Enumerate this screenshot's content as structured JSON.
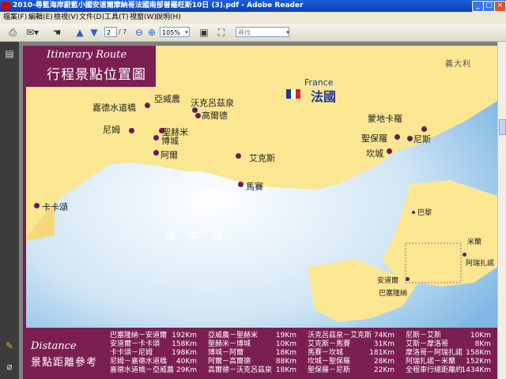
{
  "window": {
    "title": "2010-尋藍海岸蔚藍小國安道爾摩納哥法國南部普羅旺斯10日 (3).pdf - Adobe Reader",
    "minimize": "_",
    "maximize": "□",
    "close": "×"
  },
  "menu": [
    "檔案(F)",
    "編輯(E)",
    "檢視(V)",
    "文件(D)",
    "工具(T)",
    "視窗(W)",
    "說明(H)"
  ],
  "toolbar": {
    "page_current": "2",
    "page_total": "/ 7",
    "zoom": "105%",
    "search_placeholder": "尋找",
    "icons": [
      "print-icon",
      "email-icon",
      "hand-icon",
      "prev-page-icon",
      "next-page-icon",
      "zoom-out-icon",
      "zoom-in-icon",
      "fit-page-icon",
      "full-screen-icon"
    ]
  },
  "sidebar": {
    "icons": [
      "pages-icon",
      "comments-icon",
      "attachments-icon"
    ]
  },
  "page": {
    "itinerary": {
      "en": "Itinerary Route",
      "zh": "行程景點位置圖"
    },
    "country_en": "France",
    "country_zh": "法國",
    "neighbor": "義大利",
    "sea": "地 中 海",
    "flag_colors": [
      "#1e3a96",
      "#ffffff",
      "#d0262e"
    ],
    "places": [
      "嘉德水道橋",
      "亞威農",
      "沃克呂茲泉",
      "高爾德",
      "尼姆",
      "聖赫米",
      "博城",
      "阿爾",
      "艾克斯",
      "馬賽",
      "卡卡頌",
      "蒙地卡羅",
      "聖保羅",
      "尼斯",
      "坎城",
      "巴黎",
      "米蘭",
      "阿瑞扎諾",
      "安道爾",
      "巴塞隆納"
    ],
    "distance": {
      "en": "Distance",
      "zh": "景點距離參考",
      "columns": [
        [
          {
            "route": "巴塞隆納－安道爾",
            "km": "192Km"
          },
          {
            "route": "安道爾－卡卡頌",
            "km": "158Km"
          },
          {
            "route": "卡卡頌－尼姆",
            "km": "198Km"
          },
          {
            "route": "尼姆－嘉德水道橋",
            "km": "40Km"
          },
          {
            "route": "嘉德水道橋－亞威農",
            "km": "29Km"
          }
        ],
        [
          {
            "route": "亞威農－聖赫米",
            "km": "19Km"
          },
          {
            "route": "聖赫米－博城",
            "km": "10Km"
          },
          {
            "route": "博城－阿爾",
            "km": "18Km"
          },
          {
            "route": "阿爾－高爾德",
            "km": "88Km"
          },
          {
            "route": "高爾德－沃克呂茲泉",
            "km": "18Km"
          }
        ],
        [
          {
            "route": "沃克呂茲泉－艾克斯",
            "km": "74Km"
          },
          {
            "route": "艾克斯－馬賽",
            "km": "31Km"
          },
          {
            "route": "馬賽－坎城",
            "km": "181Km"
          },
          {
            "route": "坎城－聖保羅",
            "km": "28Km"
          },
          {
            "route": "聖保羅－尼斯",
            "km": "22Km"
          }
        ],
        [
          {
            "route": "尼斯－艾斯",
            "km": "10Km"
          },
          {
            "route": "艾斯－摩洛哥",
            "km": "8Km"
          },
          {
            "route": "摩洛哥－阿瑞扎諾",
            "km": "158Km"
          },
          {
            "route": "阿瑞扎諾－米蘭",
            "km": "152Km"
          },
          {
            "route": "全程車行總距離約",
            "km": "1434Km"
          }
        ]
      ]
    }
  }
}
